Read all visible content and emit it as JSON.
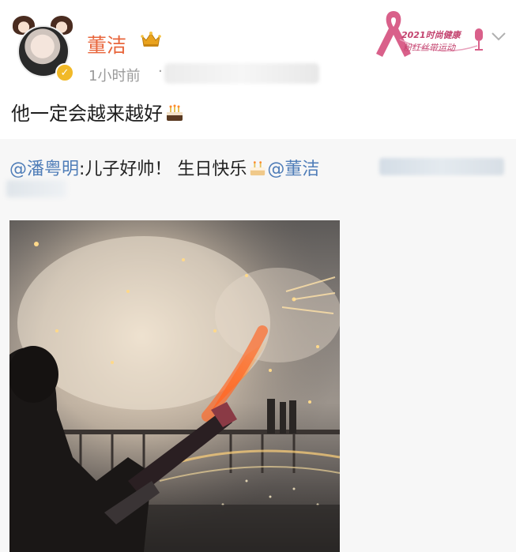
{
  "post": {
    "username": "董洁",
    "time": "1小时前",
    "time_sep": "·",
    "text": "他一定会越来越好"
  },
  "badge": {
    "line1": "2021时尚健康",
    "line2": "粉红丝带运动"
  },
  "repost": {
    "mention": "@潘粤明",
    "text": ":儿子好帅！ 生日快乐",
    "mention2": "@董洁"
  },
  "colors": {
    "username": "#e8663c",
    "mention": "#4f7db8",
    "ribbon": "#d9608a",
    "verified": "#f1b928"
  },
  "icons": [
    "crown-icon",
    "verified-icon",
    "pink-ribbon-icon",
    "microphone-icon",
    "chevron-down-icon",
    "cake-icon"
  ]
}
